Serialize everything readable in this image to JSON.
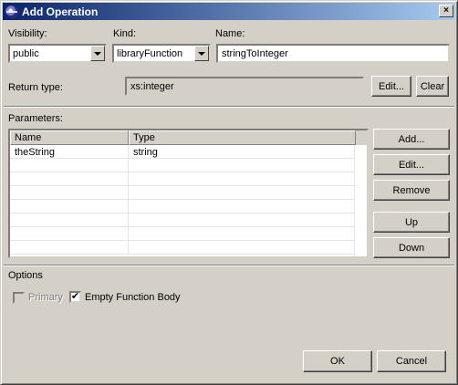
{
  "window": {
    "title": "Add Operation",
    "close_glyph": "×"
  },
  "visibility": {
    "label": "Visibility:",
    "value": "public"
  },
  "kind": {
    "label": "Kind:",
    "value": "libraryFunction"
  },
  "name": {
    "label": "Name:",
    "value": "stringToInteger"
  },
  "return_type": {
    "label": "Return type:",
    "value": "xs:integer",
    "edit_label": "Edit...",
    "clear_label": "Clear"
  },
  "parameters": {
    "label": "Parameters:",
    "columns": [
      "Name",
      "Type"
    ],
    "rows": [
      {
        "name": "theString",
        "type": "string"
      }
    ],
    "add_label": "Add...",
    "edit_label": "Edit...",
    "remove_label": "Remove",
    "up_label": "Up",
    "down_label": "Down"
  },
  "options": {
    "label": "Options",
    "primary": {
      "label": "Primary",
      "checked": false,
      "enabled": false
    },
    "empty_body": {
      "label": "Empty Function Body",
      "checked": true,
      "enabled": true
    }
  },
  "footer": {
    "ok_label": "OK",
    "cancel_label": "Cancel"
  }
}
